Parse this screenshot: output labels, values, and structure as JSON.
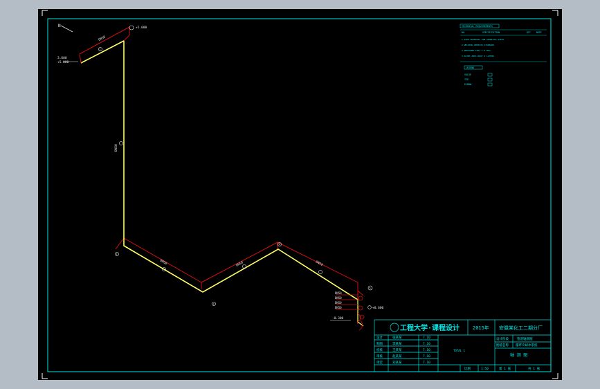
{
  "colors": {
    "background": "#000000",
    "frame": "#00e5e5",
    "pipe": "#ffff66",
    "pipe_red": "#d01010",
    "annotation": "#e8e8e8",
    "table_text": "#00e5e5",
    "outer": "#b4bcc6"
  },
  "drawing": {
    "north_mark": "N",
    "pipe_size_top": "DN50",
    "pipe_size_mid": "DN50",
    "pipe_size_r1": "DN50",
    "pipe_size_r2": "DN50",
    "pipe_size_r3": "DN50",
    "elev_left": "3.600",
    "elev_left_note": "+5.000",
    "elev_top": "+5.000",
    "elev_right": "+0.600",
    "elev_bottom": "-0.300",
    "node_top": "1",
    "node_left_bottom": "2",
    "node_mid_low": "3",
    "node_mid_high": "4",
    "node_right": "5",
    "valve_labels": [
      "DN50",
      "DN50",
      "DN50",
      "DN50"
    ]
  },
  "notes": {
    "title": "TECHNICAL REQUIREMENTS",
    "header": [
      "NO.",
      "SPECIFICATION",
      "QTY",
      "NOTE"
    ],
    "lines": [
      "1  PIPE MATERIAL 20# SEAMLESS STEEL",
      "2  WELDING GB50236 STANDARD",
      "3  PRESSURE TEST 1.5 MPa",
      "4  PAINT  ANTI-RUST  2 LAYERS"
    ],
    "legend_title": "LEGEND",
    "legend": [
      "VALVE",
      "TEE",
      "ELBOW"
    ]
  },
  "title_block": {
    "school": "工程大学·课程设计",
    "year": "2015年",
    "project": "安徽某化工二期分厂",
    "row2a": "设计阶段",
    "row2b": "管道轴测图",
    "row3a": "图纸名称",
    "row3b": "循环冷却水系统",
    "drawing_name": "轴 测 图",
    "left_labels": [
      "设计",
      "制图",
      "校核",
      "审核",
      "审定"
    ],
    "left_names": [
      "张某某",
      "李某某",
      "王某某",
      "赵某某",
      "刘某某"
    ],
    "left_dates": [
      "7.10",
      "7.10",
      "7.10",
      "7.10",
      "7.10"
    ],
    "scale_label": "比例",
    "scale_value": "1:50",
    "sheet_label": "第 1 张",
    "sheet_total": "共 1 张",
    "stamp": "TOTAL 1"
  }
}
